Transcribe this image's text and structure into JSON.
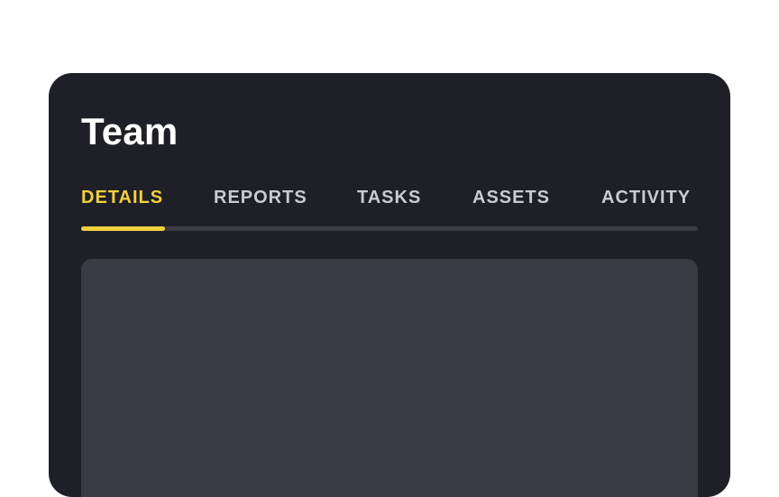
{
  "header": {
    "title": "Team"
  },
  "tabs": [
    {
      "label": "DETAILS",
      "active": true
    },
    {
      "label": "REPORTS",
      "active": false
    },
    {
      "label": "TASKS",
      "active": false
    },
    {
      "label": "ASSETS",
      "active": false
    },
    {
      "label": "ACTIVITY",
      "active": false
    }
  ],
  "colors": {
    "card_background": "#1f2027",
    "accent": "#f4d03f",
    "tab_inactive": "#c9cad3",
    "track": "#3a3b45",
    "panel": "#3a3a45"
  }
}
